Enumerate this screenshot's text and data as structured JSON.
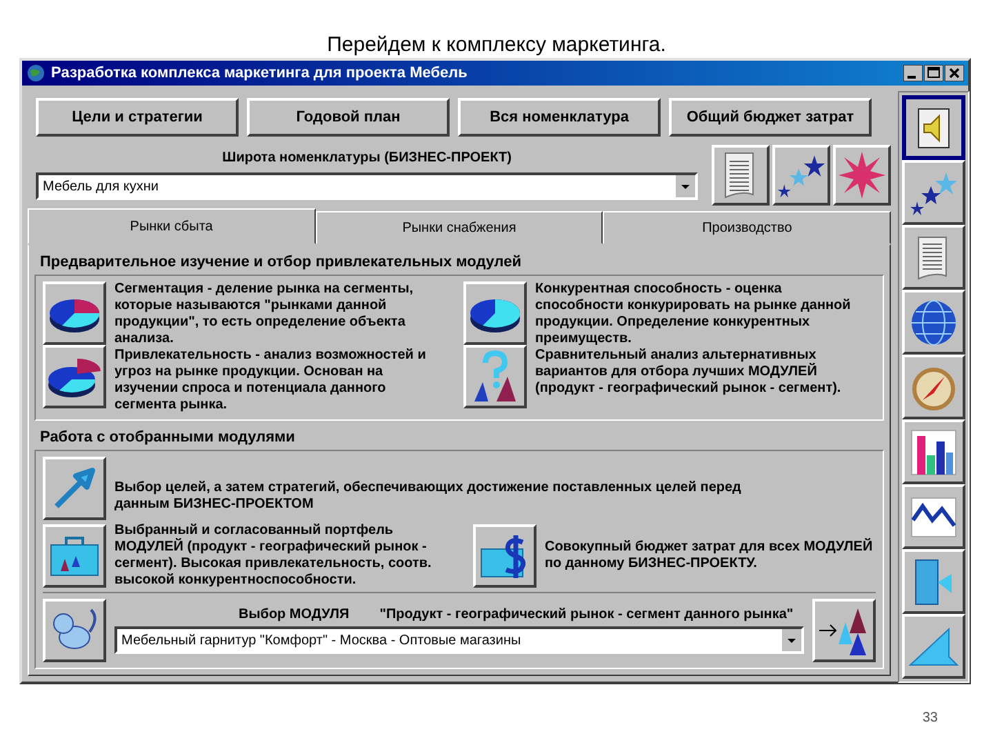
{
  "slide": {
    "title": "Перейдем к комплексу маркетинга.",
    "page_number": "33"
  },
  "window": {
    "title": "Разработка комплекса маркетинга для проекта Мебель"
  },
  "top_buttons": [
    "Цели и стратегии",
    "Годовой план",
    "Вся номенклатура",
    "Общий бюджет затрат"
  ],
  "range": {
    "label": "Широта номенклатуры (БИЗНЕС-ПРОЕКТ)",
    "value": "Мебель для кухни"
  },
  "tabs": [
    {
      "label": "Рынки сбыта",
      "selected": true
    },
    {
      "label": "Рынки снабжения",
      "selected": false
    },
    {
      "label": "Производство",
      "selected": false
    }
  ],
  "study": {
    "heading": "Предварительное изучение и отбор привлекательных модулей",
    "columns": [
      {
        "paragraphs": [
          "Сегментация - деление рынка на сегменты, которые называются \"рынками данной продукции\", то есть определение объекта анализа.",
          "Привлекательность - анализ возможностей и угроз на рынке продукции. Основан на изучении спроса и потенциала данного сегмента рынка."
        ]
      },
      {
        "paragraphs": [
          "Конкурентная способность - оценка способности конкурировать на рынке данной продукции. Определение конкурентных преимуществ.",
          "Сравнительный анализ альтернативных вариантов для отбора лучших МОДУЛЕЙ (продукт - географический рынок - сегмент)."
        ]
      }
    ]
  },
  "work": {
    "heading": "Работа с отобранными модулями",
    "goals": "Выбор целей, а затем стратегий, обеспечивающих достижение поставленных целей перед данным  БИЗНЕС-ПРОЕКТОМ",
    "portfolio": "Выбранный и согласованный портфель МОДУЛЕЙ (продукт - географический рынок - сегмент). Высокая привлекательность, соотв. высокой конкурентноспособности.",
    "budget": "Совокупный бюджет затрат для всех МОДУЛЕЙ по данному БИЗНЕС-ПРОЕКТУ.",
    "module_label": "Выбор МОДУЛЯ",
    "module_format": "\"Продукт - географический рынок - сегмент данного рынка\"",
    "module_value": "Мебельный гарнитур \"Комфорт\" - Москва - Оптовые магазины"
  },
  "toolbar": [
    {
      "selected": true
    },
    {
      "selected": false
    },
    {
      "selected": false
    },
    {
      "selected": false
    },
    {
      "selected": false
    },
    {
      "selected": false
    },
    {
      "selected": false
    },
    {
      "selected": false
    },
    {
      "selected": false
    }
  ]
}
